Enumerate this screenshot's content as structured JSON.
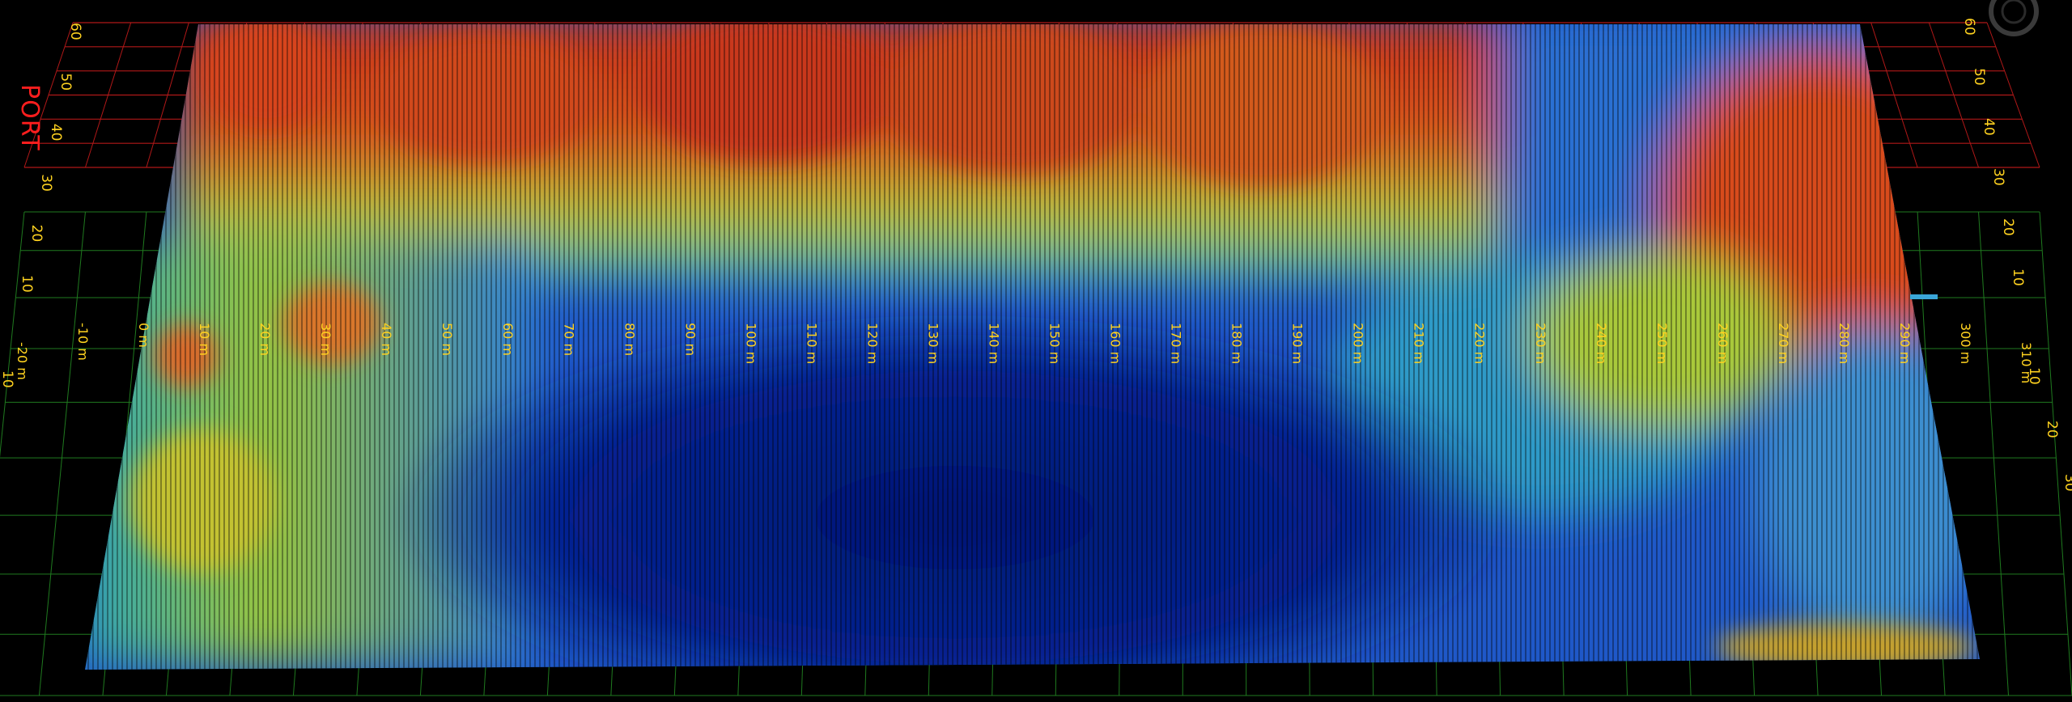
{
  "view": {
    "side_label": "PORT",
    "colors": {
      "background": "#000000",
      "red_grid": "#b01818",
      "green_grid": "#1f7a1f",
      "tick_label": "#ffd21f",
      "side_label": "#ff1e1e",
      "depth_shallow": "#d23a14",
      "depth_mid": "#f2e021",
      "depth_deep": "#061a80"
    }
  },
  "axes": {
    "along_track_labels": [
      "-20 m",
      "-10 m",
      "0 m",
      "10 m",
      "20 m",
      "30 m",
      "40 m",
      "50 m",
      "60 m",
      "70 m",
      "80 m",
      "90 m",
      "100 m",
      "110 m",
      "120 m",
      "130 m",
      "140 m",
      "150 m",
      "160 m",
      "170 m",
      "180 m",
      "190 m",
      "200 m",
      "210 m",
      "220 m",
      "230 m",
      "240 m",
      "250 m",
      "260 m",
      "270 m",
      "280 m",
      "290 m",
      "300 m",
      "310 m"
    ],
    "port_left_labels": [
      "60",
      "50",
      "40",
      "30",
      "20",
      "10"
    ],
    "port_right_labels": [
      "60",
      "50",
      "40",
      "30",
      "20",
      "10"
    ],
    "starboard_left_labels": [
      "10"
    ],
    "starboard_right_labels": [
      "10",
      "20",
      "30"
    ]
  }
}
